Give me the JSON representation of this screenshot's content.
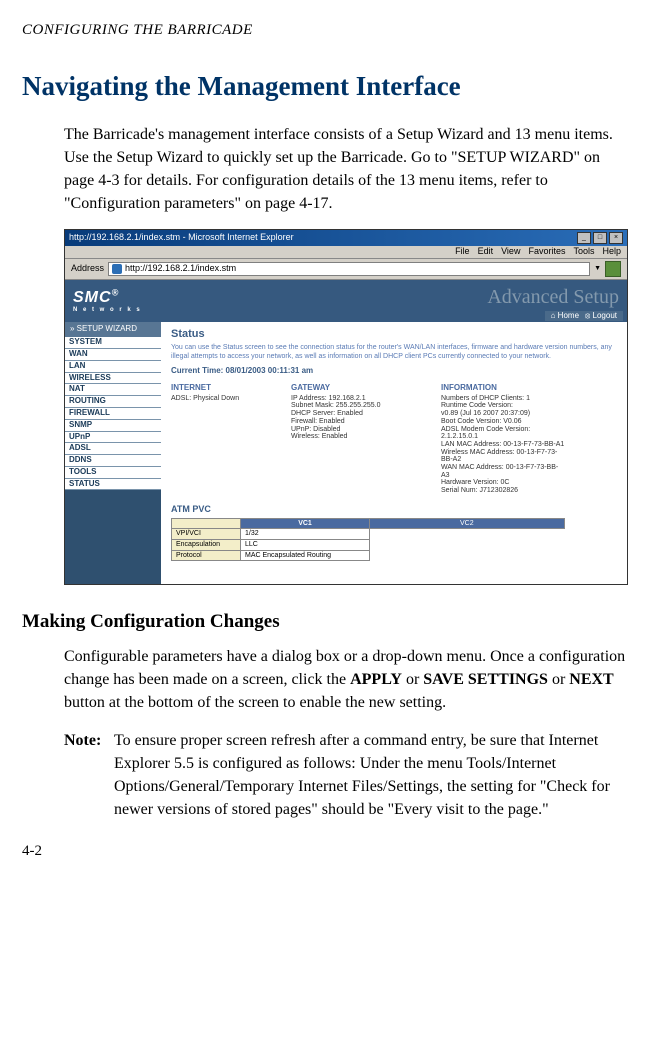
{
  "running_header": "CONFIGURING THE BARRICADE",
  "h1": "Navigating the Management Interface",
  "para1": "The Barricade's management interface consists of a Setup Wizard and 13 menu items. Use the Setup Wizard to quickly set up the Barricade. Go to \"SETUP WIZARD\" on  page 4-3 for details. For configuration details of the 13 menu items, refer to \"Configuration parameters\" on page 4-17.",
  "h2": "Making Configuration Changes",
  "para2_pre": "Configurable parameters have a dialog box or a drop-down menu. Once a configuration change has been made on a screen, click the ",
  "apply": "APPLY",
  "para2_or1": " or ",
  "save": " SAVE SETTINGS",
  "para2_or2": " or ",
  "next": "NEXT",
  "para2_post": " button at the bottom of the screen to enable the new setting.",
  "note_label": "Note:",
  "note_text": "To ensure proper screen refresh after a command entry, be sure that Internet Explorer 5.5 is configured as follows: Under the menu Tools/Internet Options/General/Temporary Internet Files/Settings, the setting for \"Check for newer versions of stored pages\" should be \"Every visit to the page.\"",
  "page_number": "4-2",
  "screenshot": {
    "window_title": "http://192.168.2.1/index.stm - Microsoft Internet Explorer",
    "menus": [
      "File",
      "Edit",
      "View",
      "Favorites",
      "Tools",
      "Help"
    ],
    "address_label": "Address",
    "url": "http://192.168.2.1/index.stm",
    "brand": "SMC",
    "brand_r": "®",
    "brand_sub": "N e t w o r k s",
    "adv_setup": "Advanced Setup",
    "home_link": "Home",
    "logout_link": "Logout",
    "wizard": "» SETUP WIZARD",
    "menu_items": [
      "SYSTEM",
      "WAN",
      "LAN",
      "WIRELESS",
      "NAT",
      "ROUTING",
      "FIREWALL",
      "SNMP",
      "UPnP",
      "ADSL",
      "DDNS",
      "TOOLS",
      "STATUS"
    ],
    "status_title": "Status",
    "status_desc": "You can use the Status screen to see the connection status for the router's WAN/LAN interfaces, firmware and hardware version numbers, any illegal attempts to access your network, as well as information on all DHCP client PCs currently connected to your network.",
    "current_time": "Current Time: 08/01/2003 00:11:31 am",
    "col_internet_head": "INTERNET",
    "col_internet_lines": [
      "ADSL:   Physical Down"
    ],
    "col_gateway_head": "GATEWAY",
    "col_gateway_lines": [
      "IP Address:   192.168.2.1",
      "Subnet Mask:   255.255.255.0",
      "DHCP Server:   Enabled",
      "Firewall:   Enabled",
      "UPnP:   Disabled",
      "Wireless:   Enabled"
    ],
    "col_info_head": "INFORMATION",
    "col_info_lines": [
      "Numbers of DHCP Clients:   1",
      "Runtime Code Version:",
      "   v0.89 (Jul 16 2007 20:37:09)",
      "Boot Code Version:   V0.06",
      "ADSL Modem Code Version:",
      "2.1.2.15.0.1",
      "LAN MAC Address: 00-13-F7-73-BB-A1",
      "Wireless MAC Address: 00-13-F7-73-",
      "BB-A2",
      "WAN MAC Address: 00-13-F7-73-BB-",
      "A3",
      "Hardware Version:   0C",
      "Serial Num:   J712302826"
    ],
    "atm_title": "ATM PVC",
    "vc1_head": "VC1",
    "vc2_head": "VC2",
    "atm_rows": [
      {
        "label": "VPI/VCI",
        "value": "1/32"
      },
      {
        "label": "Encapsulation",
        "value": "LLC"
      },
      {
        "label": "Protocol",
        "value": "MAC Encapsulated Routing"
      }
    ]
  }
}
